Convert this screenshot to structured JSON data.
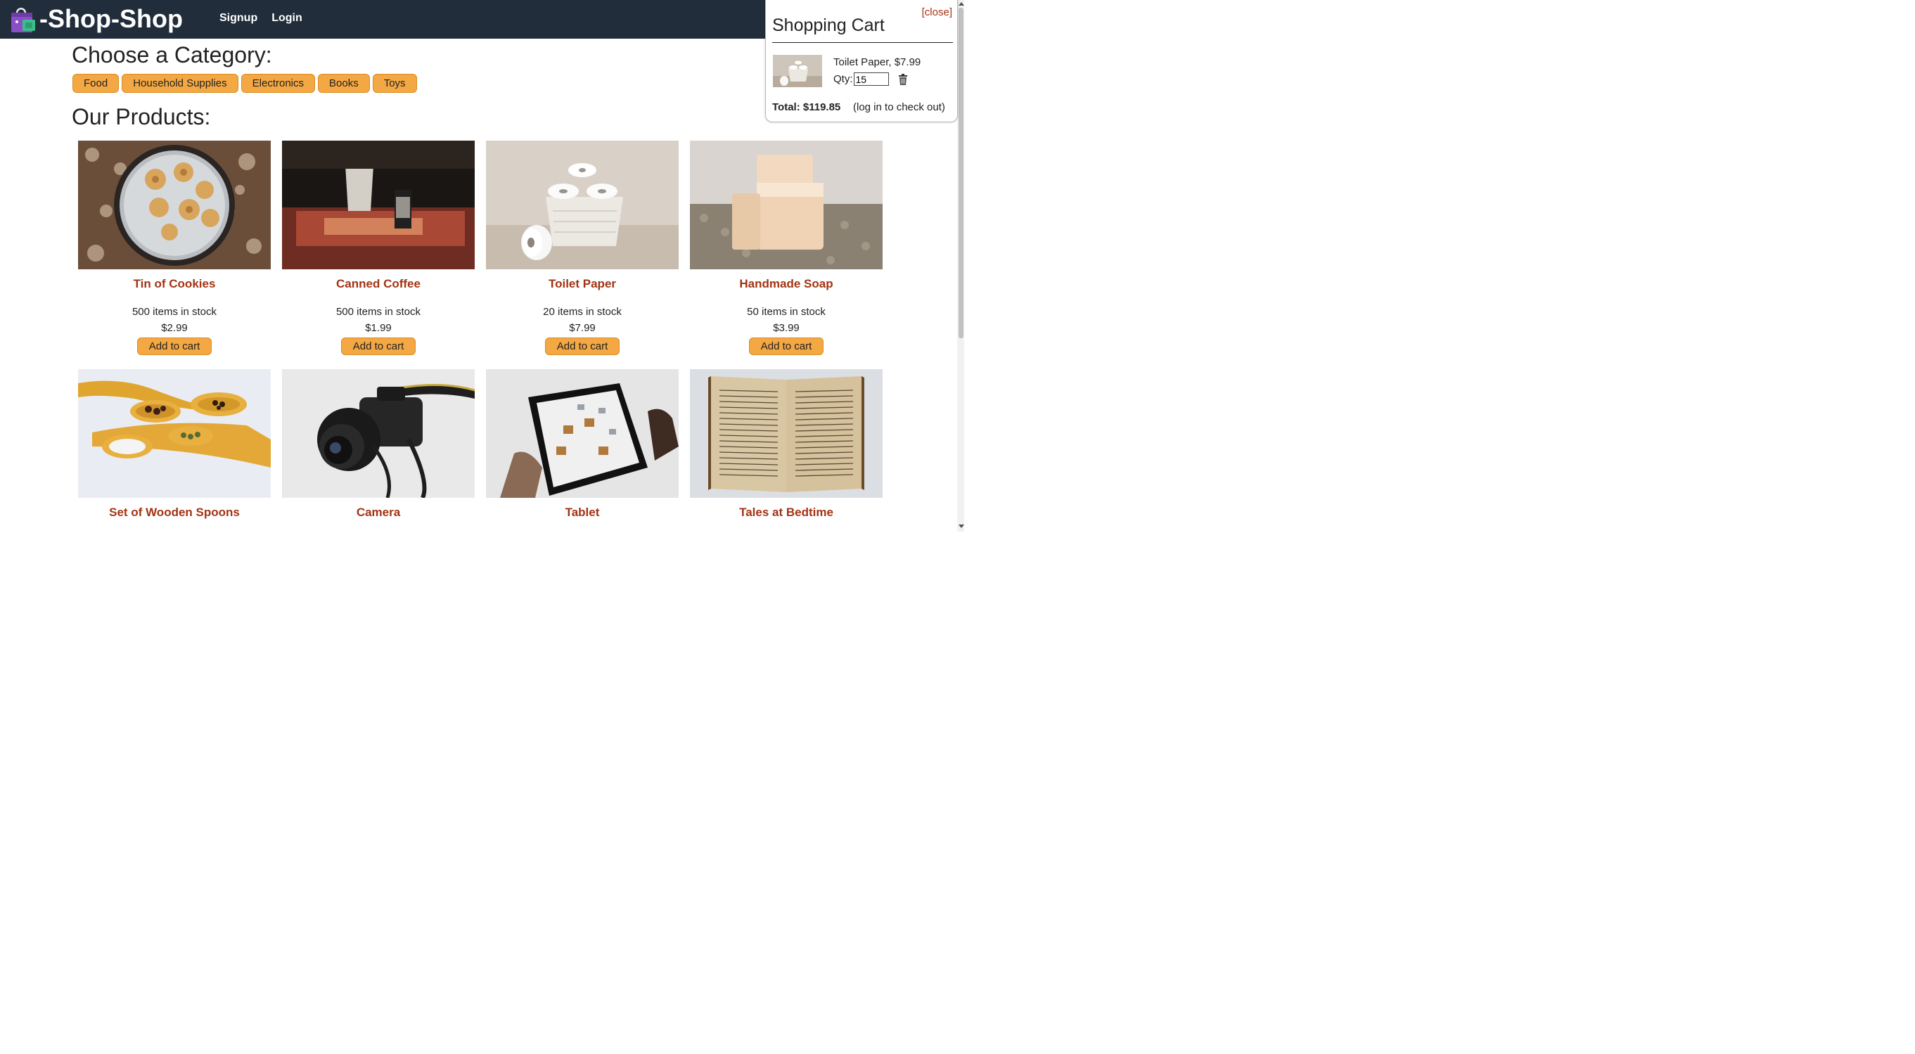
{
  "header": {
    "brand": "-Shop-Shop",
    "nav": [
      "Signup",
      "Login"
    ],
    "bg_color": "#212d3b"
  },
  "categories": {
    "title": "Choose a Category:",
    "items": [
      "Food",
      "Household Supplies",
      "Electronics",
      "Books",
      "Toys"
    ]
  },
  "products": {
    "title": "Our Products:",
    "add_label": "Add to cart",
    "items": [
      {
        "name": "Tin of Cookies",
        "stock": "500 items in stock",
        "price": "$2.99",
        "image": "cookie-tin-photo"
      },
      {
        "name": "Canned Coffee",
        "stock": "500 items in stock",
        "price": "$1.99",
        "image": "canned-coffee-photo"
      },
      {
        "name": "Toilet Paper",
        "stock": "20 items in stock",
        "price": "$7.99",
        "image": "toilet-paper-photo"
      },
      {
        "name": "Handmade Soap",
        "stock": "50 items in stock",
        "price": "$3.99",
        "image": "soap-photo"
      },
      {
        "name": "Set of Wooden Spoons",
        "image": "wooden-spoons-photo"
      },
      {
        "name": "Camera",
        "image": "camera-photo"
      },
      {
        "name": "Tablet",
        "image": "tablet-photo"
      },
      {
        "name": "Tales at Bedtime",
        "image": "book-photo"
      }
    ]
  },
  "cart": {
    "close_label": "[close]",
    "title": "Shopping Cart",
    "item_text": "Toilet Paper, $7.99",
    "qty_label": "Qty:",
    "qty_value": "15",
    "total": "Total: $119.85",
    "note": "(log in to check out)"
  },
  "colors": {
    "accent": "#f4a843",
    "link": "#a33313"
  }
}
